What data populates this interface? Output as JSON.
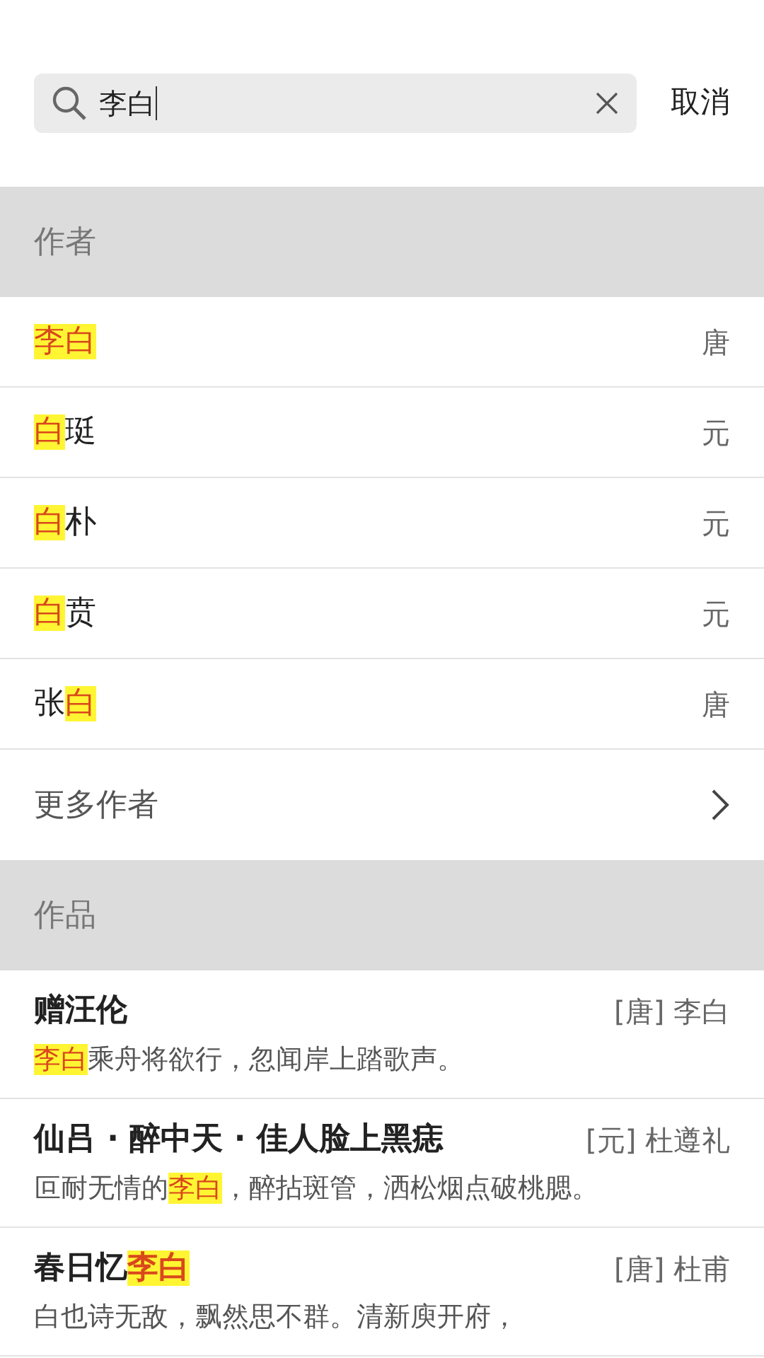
{
  "search": {
    "value": "李白",
    "cancel": "取消"
  },
  "sections": [
    {
      "title": "作者",
      "kind": "authors",
      "items": [
        {
          "name": [
            {
              "text": "李白",
              "highlight": true
            }
          ],
          "dynasty": "唐"
        },
        {
          "name": [
            {
              "text": "白",
              "highlight": true
            },
            {
              "text": "珽",
              "highlight": false
            }
          ],
          "dynasty": "元"
        },
        {
          "name": [
            {
              "text": "白",
              "highlight": true
            },
            {
              "text": "朴",
              "highlight": false
            }
          ],
          "dynasty": "元"
        },
        {
          "name": [
            {
              "text": "白",
              "highlight": true
            },
            {
              "text": "贲",
              "highlight": false
            }
          ],
          "dynasty": "元"
        },
        {
          "name": [
            {
              "text": "张",
              "highlight": false
            },
            {
              "text": "白",
              "highlight": true
            }
          ],
          "dynasty": "唐"
        }
      ],
      "more": "更多作者"
    },
    {
      "title": "作品",
      "kind": "works",
      "items": [
        {
          "title": [
            {
              "text": "赠汪伦",
              "highlight": false
            }
          ],
          "author": "[唐] 李白",
          "line": [
            {
              "text": "李白",
              "highlight": true
            },
            {
              "text": "乘舟将欲行，忽闻岸上踏歌声。",
              "highlight": false
            }
          ]
        },
        {
          "title": [
            {
              "text": "仙吕 · 醉中天 · 佳人脸上黑痣",
              "highlight": false
            }
          ],
          "author": "[元] 杜遵礼",
          "line": [
            {
              "text": "叵耐无情的",
              "highlight": false
            },
            {
              "text": "李白",
              "highlight": true
            },
            {
              "text": "，醉拈斑管，洒松烟点破桃腮。",
              "highlight": false
            }
          ]
        },
        {
          "title": [
            {
              "text": "春日忆",
              "highlight": false
            },
            {
              "text": "李白",
              "highlight": true
            }
          ],
          "author": "[唐] 杜甫",
          "line": [
            {
              "text": "白也诗无敌，飘然思不群。清新庾开府，",
              "highlight": false
            }
          ]
        }
      ]
    }
  ]
}
